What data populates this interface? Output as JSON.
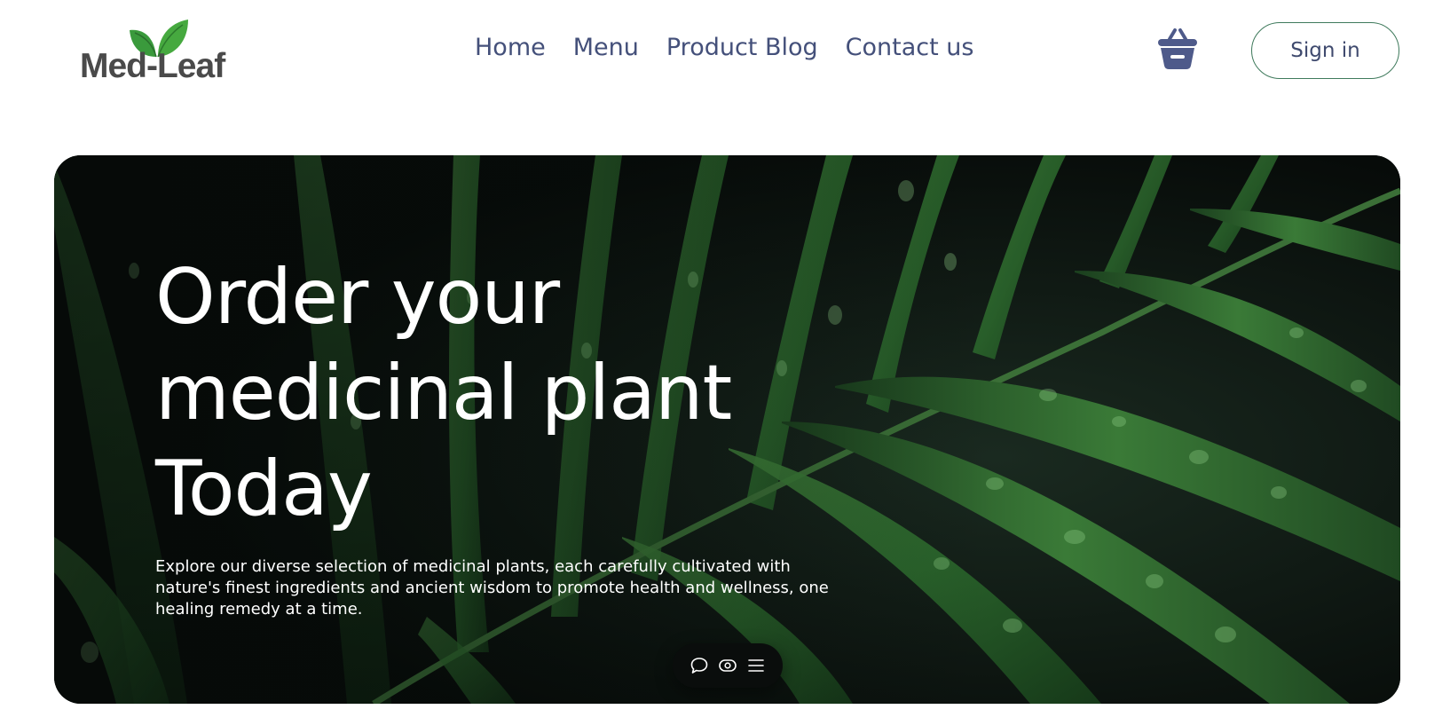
{
  "brand": {
    "name": "Med-Leaf"
  },
  "nav": {
    "items": [
      {
        "label": "Home"
      },
      {
        "label": "Menu"
      },
      {
        "label": "Product Blog"
      },
      {
        "label": "Contact us"
      }
    ]
  },
  "header": {
    "cart_icon": "shopping-basket-icon",
    "signin_label": "Sign in"
  },
  "hero": {
    "title_lines": [
      "Order your",
      "medicinal plant",
      "Today"
    ],
    "description": "Explore our diverse selection of medicinal plants, each carefully cultivated with nature's finest ingredients and ancient wisdom to promote health and wellness, one healing remedy at a time.",
    "toolbar_icons": [
      "chat-bubble-icon",
      "eye-icon",
      "menu-lines-icon"
    ]
  },
  "colors": {
    "nav_text": "#44507a",
    "cart_icon": "#4e5a8a",
    "signin_border": "#3f7a5c",
    "logo_leaf": "#3a9a3c",
    "hero_bg": "#0c1210"
  }
}
